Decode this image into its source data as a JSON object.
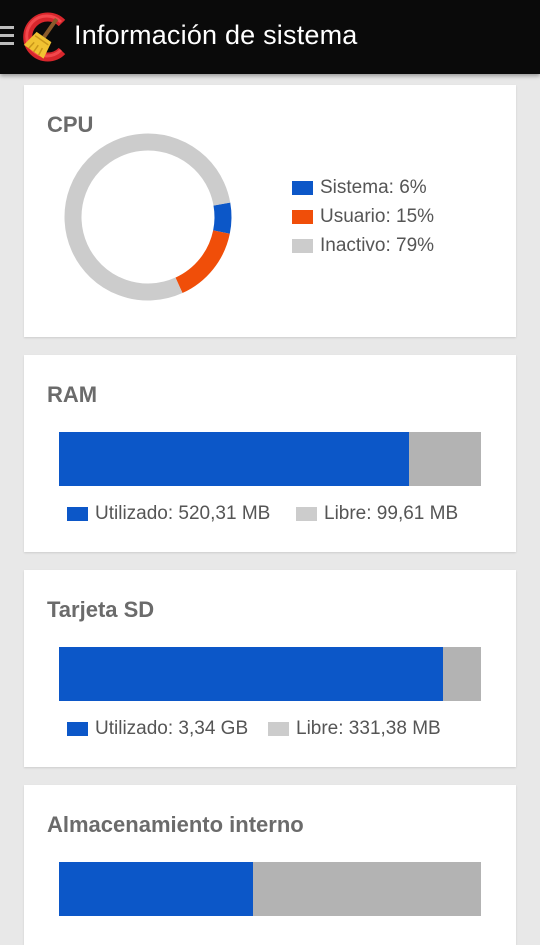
{
  "app": {
    "title": "Información de sistema",
    "menu_icon": "hamburger-icon",
    "logo_icon": "ccleaner-logo"
  },
  "colors": {
    "used": "#0c57c8",
    "user": "#f04e09",
    "idle": "#cccccc",
    "free": "#b3b3b3"
  },
  "cpu": {
    "title": "CPU",
    "legend": [
      {
        "label": "Sistema: 6%",
        "color": "#0c57c8",
        "percent": 6
      },
      {
        "label": "Usuario: 15%",
        "color": "#f04e09",
        "percent": 15
      },
      {
        "label": "Inactivo: 79%",
        "color": "#cccccc",
        "percent": 79
      }
    ]
  },
  "ram": {
    "title": "RAM",
    "used_fraction": 0.83,
    "used_label": "Utilizado: 520,31 MB",
    "free_label": "Libre: 99,61 MB"
  },
  "sd": {
    "title": "Tarjeta SD",
    "used_fraction": 0.91,
    "used_label": "Utilizado: 3,34 GB",
    "free_label": "Libre: 331,38 MB"
  },
  "internal": {
    "title": "Almacenamiento interno",
    "used_fraction": 0.46
  }
}
